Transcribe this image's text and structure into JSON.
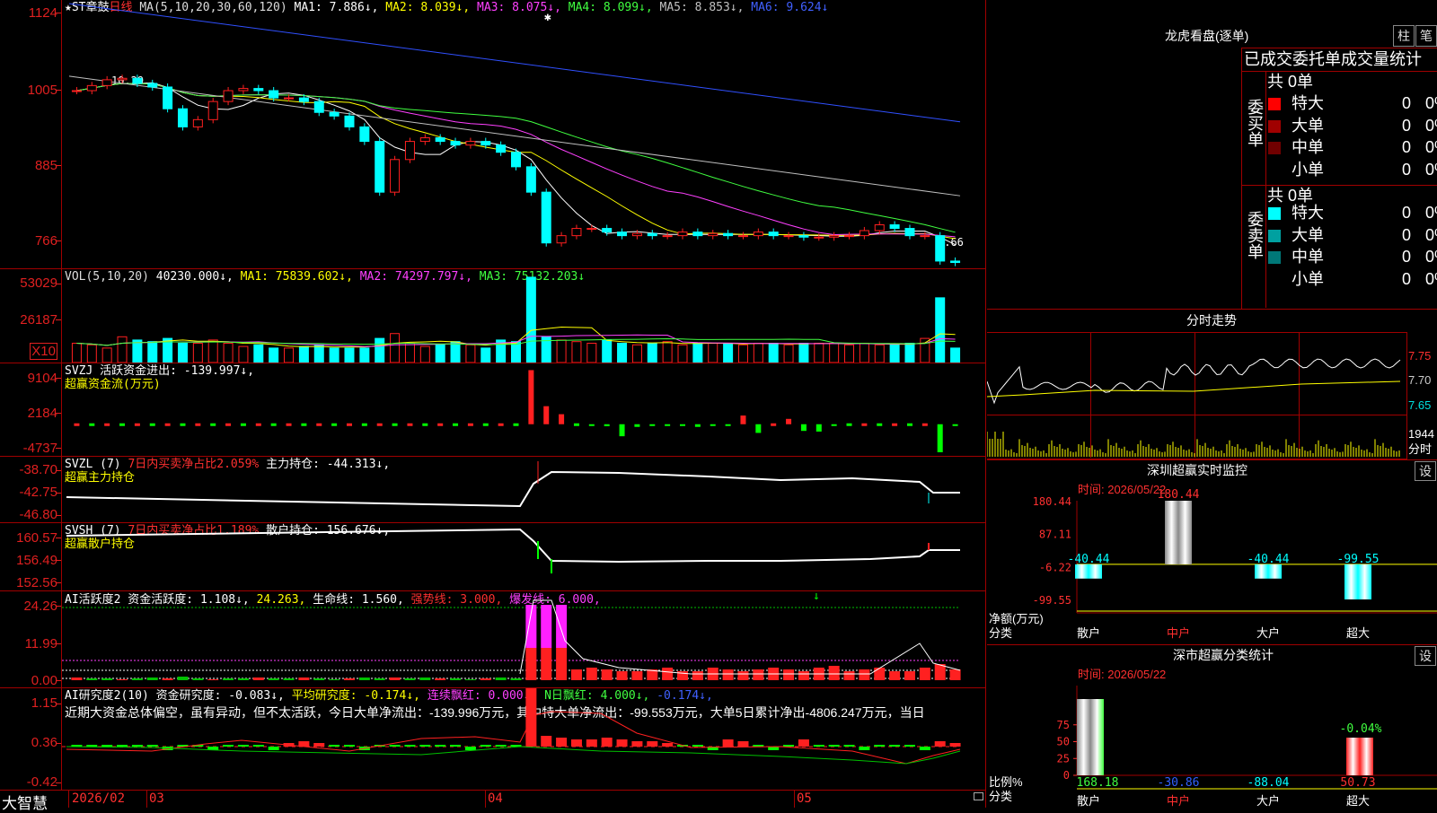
{
  "main": {
    "price_header": {
      "symbol": "★ST章鼓",
      "period": "日线",
      "ma_label": "MA(5,10,20,30,60,120)",
      "items": [
        {
          "text": "MA1: 7.886↓,",
          "color": "#ffffff"
        },
        {
          "text": "MA2: 8.039↓,",
          "color": "#ffff00"
        },
        {
          "text": "MA3: 8.075↓,",
          "color": "#ff40ff"
        },
        {
          "text": "MA4: 8.099↓,",
          "color": "#40ff40"
        },
        {
          "text": "MA5: 8.853↓,",
          "color": "#c0c0c0"
        },
        {
          "text": "MA6: 9.624↓",
          "color": "#4060ff"
        }
      ],
      "axis": [
        "1124",
        "1005",
        "885",
        "766"
      ],
      "high_marker": "10.29",
      "low_marker": "7.66"
    },
    "vol": {
      "header": "VOL(5,10,20)",
      "value": "40230.000↓,",
      "ma1": "MA1: 75839.602↓,",
      "ma2": "MA2: 74297.797↓,",
      "ma3": "MA3: 75132.203↓",
      "axis": [
        "53029",
        "26187"
      ],
      "unit": "X10"
    },
    "svzj": {
      "header": "SVZJ  活跃资金进出: -139.997↓,",
      "subtitle": "超赢资金流(万元)",
      "axis": [
        "9104",
        "2184",
        "-4737"
      ]
    },
    "svzl": {
      "header_a": "SVZL (7)",
      "header_b": "7日内买卖净占比2.059%",
      "header_c": "主力持仓: -44.313↓,",
      "subtitle": "超赢主力持仓",
      "axis": [
        "-38.70",
        "-42.75",
        "-46.80"
      ]
    },
    "svsh": {
      "header_a": "SVSH (7)",
      "header_b": "7日内买卖净占比1.189%",
      "header_c": "散户持仓: 156.676↓,",
      "subtitle": "超赢散户持仓",
      "axis": [
        "160.57",
        "156.49",
        "152.56"
      ]
    },
    "ai_active": {
      "header_a": "AI活跃度2 资金活跃度: 1.108↓,",
      "header_b": "24.263,",
      "header_c": "生命线: 1.560,",
      "header_d": "强势线: 3.000,",
      "header_e": "爆发线: 6.000,",
      "axis": [
        "24.26",
        "11.99",
        "0.00"
      ]
    },
    "ai_research": {
      "header_a": "AI研究度2(10) 资金研究度: -0.083↓,",
      "header_b": "平均研究度: -0.174↓,",
      "header_c": "连续飘红: 0.000↓,",
      "header_d": "N日飘红: 4.000↓,",
      "header_e": "-0.174↓,",
      "commentary": "近期大资金总体偏空，虽有异动，但不太活跃，今日大单净流出：-139.996万元，其中特大单净流出：-99.553万元，大单5日累计净出-4806.247万元，当日",
      "axis": [
        "1.15",
        "0.36",
        "-0.42"
      ]
    },
    "bottom_bar": {
      "brand": "大智慧",
      "dates": [
        "2026/02",
        "03",
        "04",
        "05"
      ]
    }
  },
  "right_panel": {
    "dragon_tiger": {
      "title": "龙虎看盘(逐单)",
      "btn_bar": "柱",
      "btn_pen": "笔",
      "header": "已成交委托单成交量统计",
      "buy_label": "委买单",
      "sell_label": "委卖单",
      "buy_total": "共 0单",
      "sell_total": "共 0单",
      "buy_rows": [
        {
          "label": "特大",
          "count": "0",
          "pct": "0%",
          "color": "#ff0000"
        },
        {
          "label": "大单",
          "count": "0",
          "pct": "0%",
          "color": "#a00000"
        },
        {
          "label": "中单",
          "count": "0",
          "pct": "0%",
          "color": "#700000"
        },
        {
          "label": "小单",
          "count": "0",
          "pct": "0%",
          "color": ""
        }
      ],
      "sell_rows": [
        {
          "label": "特大",
          "count": "0",
          "pct": "0%",
          "color": "#00ffff"
        },
        {
          "label": "大单",
          "count": "0",
          "pct": "0%",
          "color": "#00a0a0"
        },
        {
          "label": "中单",
          "count": "0",
          "pct": "0%",
          "color": "#007878"
        },
        {
          "label": "小单",
          "count": "0",
          "pct": "0%",
          "color": ""
        }
      ]
    },
    "intraday": {
      "title": "分时走势",
      "axis": [
        "7.75",
        "7.70",
        "7.65"
      ],
      "vol_value": "1944",
      "vol_unit": "分时"
    },
    "sz_monitor": {
      "title": "深圳超赢实时监控",
      "btn": "设",
      "time": "时间: 2026/05/22",
      "axis": [
        "180.44",
        "87.11",
        "-6.22",
        "-99.55"
      ],
      "y_label": "净额(万元)",
      "x_label": "分类",
      "categories": [
        "散户",
        "中户",
        "大户",
        "超大"
      ],
      "values": [
        -40.44,
        180.44,
        -40.44,
        -99.55
      ],
      "value_labels": [
        "-40.44",
        "180.44",
        "-40.44",
        "-99.55"
      ]
    },
    "sz_class": {
      "title": "深市超赢分类统计",
      "btn": "设",
      "time": "时间: 2026/05/22",
      "axis": [
        "75",
        "50",
        "25",
        "0"
      ],
      "y_label": "比例%",
      "x_label": "分类",
      "categories": [
        "散户",
        "中户",
        "大户",
        "超大"
      ],
      "value_labels": [
        "168.18",
        "-30.86",
        "-88.04",
        "50.73"
      ],
      "top_label": "-0.04%"
    }
  },
  "chart_data": [
    {
      "type": "line",
      "title": "★ST章鼓 日线",
      "ylim": [
        7.6,
        11.3
      ],
      "x": [
        1,
        2,
        3,
        4,
        5,
        6,
        7,
        8,
        9,
        10,
        11,
        12,
        13,
        14,
        15,
        16,
        17,
        18,
        19,
        20,
        21,
        22,
        23,
        24,
        25,
        26,
        27,
        28,
        29,
        30,
        31,
        32,
        33,
        34,
        35,
        36,
        37,
        38,
        39,
        40,
        41,
        42,
        43,
        44,
        45,
        46,
        47,
        48,
        49,
        50,
        51,
        52,
        53,
        54,
        55,
        56,
        57,
        58,
        59
      ],
      "series": [
        {
          "name": "close",
          "values": [
            10.05,
            10.12,
            10.2,
            10.22,
            10.15,
            10.1,
            9.8,
            9.55,
            9.65,
            9.9,
            10.05,
            10.08,
            10.05,
            9.95,
            9.95,
            9.9,
            9.75,
            9.7,
            9.55,
            9.35,
            8.65,
            9.1,
            9.35,
            9.4,
            9.35,
            9.3,
            9.35,
            9.3,
            9.2,
            9.0,
            8.65,
            7.95,
            8.05,
            8.15,
            8.15,
            8.1,
            8.05,
            8.08,
            8.05,
            8.05,
            8.1,
            8.05,
            8.08,
            8.05,
            8.05,
            8.1,
            8.05,
            8.05,
            8.03,
            8.03,
            8.05,
            8.05,
            8.12,
            8.2,
            8.15,
            8.05,
            8.05,
            7.7,
            7.68
          ]
        }
      ]
    },
    {
      "type": "bar",
      "title": "VOL(5,10,20)",
      "categories": [],
      "series": [
        {
          "name": "VOL",
          "values": [
            12000,
            11000,
            9000,
            16000,
            14000,
            13000,
            15000,
            12000,
            12000,
            14000,
            12000,
            10000,
            11000,
            9000,
            9000,
            10000,
            11000,
            9000,
            9000,
            9000,
            15000,
            18000,
            12000,
            10000,
            11000,
            13000,
            11000,
            9000,
            14000,
            13000,
            53029,
            16000,
            14000,
            13000,
            12000,
            14000,
            12000,
            11000,
            12000,
            13000,
            11000,
            12000,
            12000,
            12000,
            11000,
            12000,
            12000,
            11000,
            12000,
            12000,
            12000,
            11000,
            12000,
            11000,
            11000,
            12000,
            15000,
            40230,
            9000
          ]
        }
      ]
    },
    {
      "type": "bar",
      "title": "SVZJ",
      "ylim": [
        -4737,
        9104
      ],
      "series": [
        {
          "name": "活跃资金进出",
          "values": [
            0,
            0,
            0,
            0,
            0,
            0,
            0,
            0,
            0,
            0,
            0,
            0,
            0,
            0,
            0,
            0,
            0,
            0,
            0,
            0,
            0,
            0,
            0,
            0,
            0,
            0,
            0,
            0,
            0,
            0,
            8100,
            2700,
            1500,
            0,
            -100,
            -300,
            -1800,
            -400,
            -100,
            -150,
            -200,
            -400,
            -100,
            -150,
            1300,
            -1300,
            0,
            800,
            -1000,
            -1100,
            -150,
            0,
            0,
            0,
            0,
            0,
            0,
            -4200,
            -140
          ]
        }
      ]
    }
  ]
}
